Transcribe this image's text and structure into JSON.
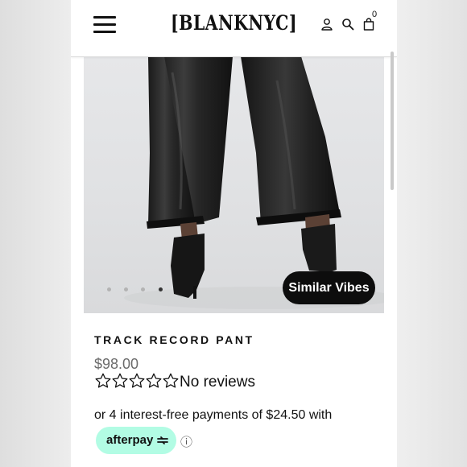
{
  "header": {
    "logo": "[BLANKNYC]",
    "cart_count": "0",
    "icons": [
      "menu-icon",
      "account-icon",
      "search-icon",
      "cart-icon"
    ]
  },
  "gallery": {
    "image_subject": "Black faux-leather cropped wide-leg pants with black ankle boots",
    "slide_count": 4,
    "active_slide": 4,
    "similar_vibes_label": "Similar Vibes"
  },
  "product": {
    "title": "TRACK RECORD PANT",
    "price": "$98.00",
    "rating": 0,
    "rating_max": 5,
    "reviews_label": "No reviews"
  },
  "payment": {
    "installments_text": "or 4 interest-free payments of $24.50 with",
    "afterpay_label": "afterpay",
    "info_glyph": "ⓘ"
  },
  "colors": {
    "accent_afterpay": "#b2fce4",
    "button_bg": "#0d0d0d",
    "price_text": "#6b6b6b"
  }
}
